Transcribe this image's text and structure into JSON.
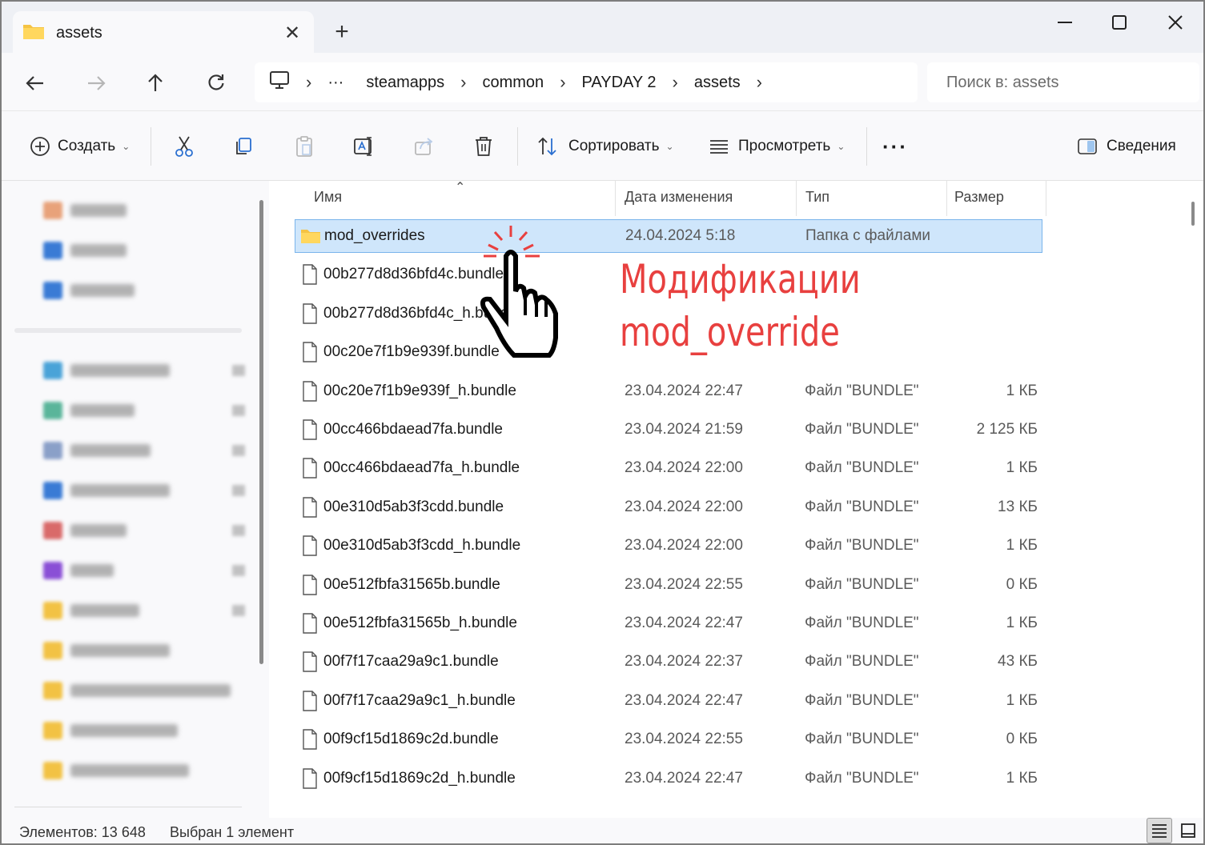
{
  "window": {
    "tab_title": "assets",
    "new_tab": "+",
    "controls": {
      "minimize": "—",
      "maximize": "☐",
      "close": "✕"
    }
  },
  "navigation": {
    "back": "←",
    "forward": "→",
    "up": "↑",
    "refresh": "↻",
    "breadcrumb": [
      "steamapps",
      "common",
      "PAYDAY 2",
      "assets"
    ],
    "overflow": "···",
    "search_placeholder": "Поиск в: assets"
  },
  "toolbar": {
    "create_label": "Создать",
    "sort_label": "Сортировать",
    "view_label": "Просмотреть",
    "more": "···",
    "details_label": "Сведения"
  },
  "columns": {
    "name": "Имя",
    "date": "Дата изменения",
    "type": "Тип",
    "size": "Размер"
  },
  "files": [
    {
      "name": "mod_overrides",
      "date": "24.04.2024 5:18",
      "type": "Папка с файлами",
      "size": "",
      "kind": "folder",
      "selected": true
    },
    {
      "name": "00b277d8d36bfd4c.bundle",
      "date": "",
      "type": "",
      "size": "",
      "kind": "file"
    },
    {
      "name": "00b277d8d36bfd4c_h.bundle",
      "date": "",
      "type": "",
      "size": "",
      "kind": "file"
    },
    {
      "name": "00c20e7f1b9e939f.bundle",
      "date": "",
      "type": "",
      "size": "",
      "kind": "file"
    },
    {
      "name": "00c20e7f1b9e939f_h.bundle",
      "date": "23.04.2024 22:47",
      "type": "Файл \"BUNDLE\"",
      "size": "1 КБ",
      "kind": "file"
    },
    {
      "name": "00cc466bdaead7fa.bundle",
      "date": "23.04.2024 21:59",
      "type": "Файл \"BUNDLE\"",
      "size": "2 125 КБ",
      "kind": "file"
    },
    {
      "name": "00cc466bdaead7fa_h.bundle",
      "date": "23.04.2024 22:00",
      "type": "Файл \"BUNDLE\"",
      "size": "1 КБ",
      "kind": "file"
    },
    {
      "name": "00e310d5ab3f3cdd.bundle",
      "date": "23.04.2024 22:00",
      "type": "Файл \"BUNDLE\"",
      "size": "13 КБ",
      "kind": "file"
    },
    {
      "name": "00e310d5ab3f3cdd_h.bundle",
      "date": "23.04.2024 22:00",
      "type": "Файл \"BUNDLE\"",
      "size": "1 КБ",
      "kind": "file"
    },
    {
      "name": "00e512fbfa31565b.bundle",
      "date": "23.04.2024 22:55",
      "type": "Файл \"BUNDLE\"",
      "size": "0 КБ",
      "kind": "file"
    },
    {
      "name": "00e512fbfa31565b_h.bundle",
      "date": "23.04.2024 22:47",
      "type": "Файл \"BUNDLE\"",
      "size": "1 КБ",
      "kind": "file"
    },
    {
      "name": "00f7f17caa29a9c1.bundle",
      "date": "23.04.2024 22:37",
      "type": "Файл \"BUNDLE\"",
      "size": "43 КБ",
      "kind": "file"
    },
    {
      "name": "00f7f17caa29a9c1_h.bundle",
      "date": "23.04.2024 22:47",
      "type": "Файл \"BUNDLE\"",
      "size": "1 КБ",
      "kind": "file"
    },
    {
      "name": "00f9cf15d1869c2d.bundle",
      "date": "23.04.2024 22:55",
      "type": "Файл \"BUNDLE\"",
      "size": "0 КБ",
      "kind": "file"
    },
    {
      "name": "00f9cf15d1869c2d_h.bundle",
      "date": "23.04.2024 22:47",
      "type": "Файл \"BUNDLE\"",
      "size": "1 КБ",
      "kind": "file"
    }
  ],
  "status": {
    "count": "Элементов: 13 648",
    "selection": "Выбран 1 элемент"
  },
  "annotation": {
    "line1": "Модификации",
    "line2": "mod_override",
    "color": "#e8403f"
  },
  "sidebar_icon_colors": [
    "#e8a27a",
    "#3a7bd5",
    "#3a7bd5",
    "#4aa3d8",
    "#5ab59a",
    "#8aa0c8",
    "#3a7bd5",
    "#d96a6a",
    "#8a4fd6",
    "#f2c244",
    "#f2c244",
    "#f2c244",
    "#f2c244",
    "#f2c244"
  ]
}
